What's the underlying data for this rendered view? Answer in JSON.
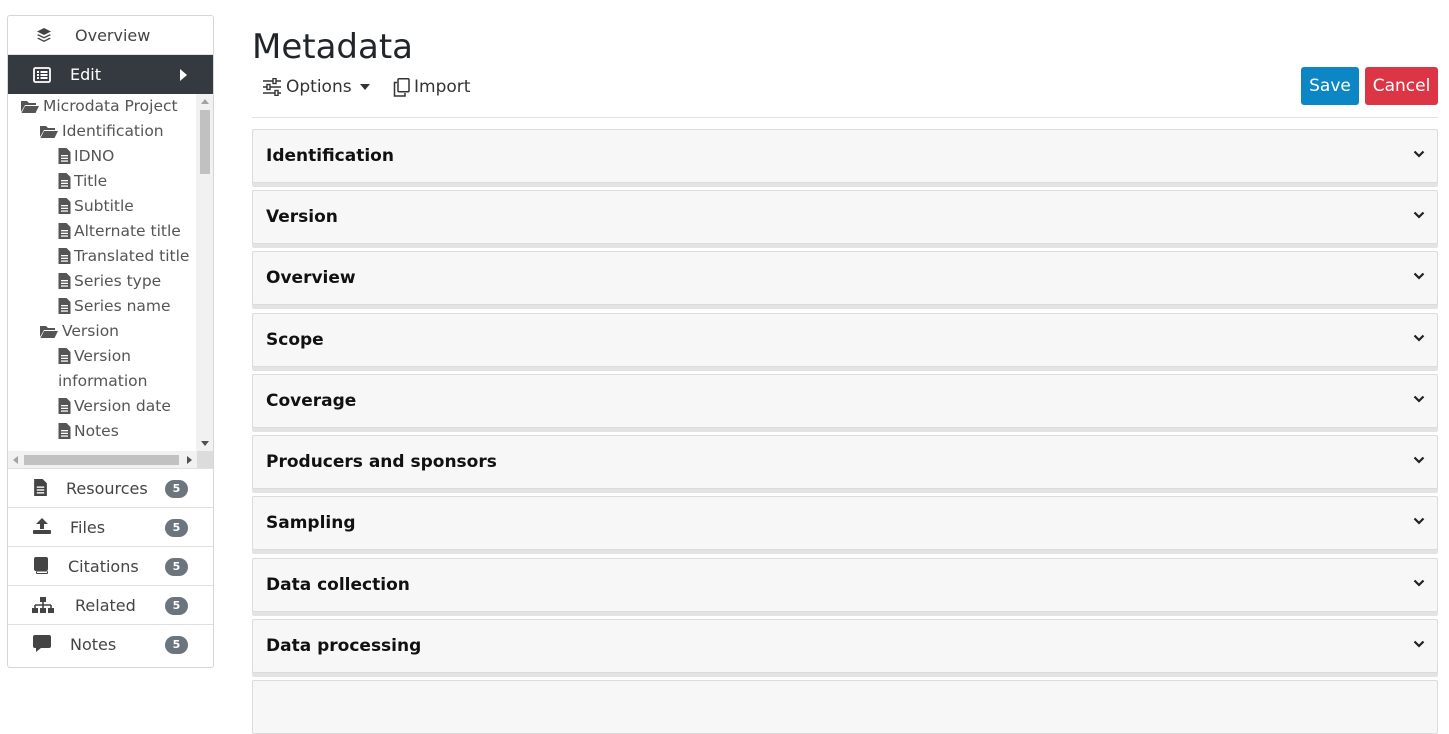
{
  "sidebar": {
    "overview_label": "Overview",
    "edit_label": "Edit",
    "tree": {
      "root": "Microdata Project",
      "items": [
        {
          "label": "Identification",
          "type": "folder"
        },
        {
          "label": "IDNO",
          "type": "file"
        },
        {
          "label": "Title",
          "type": "file"
        },
        {
          "label": "Subtitle",
          "type": "file"
        },
        {
          "label": "Alternate title",
          "type": "file"
        },
        {
          "label": "Translated title",
          "type": "file"
        },
        {
          "label": "Series type",
          "type": "file"
        },
        {
          "label": "Series name",
          "type": "file"
        },
        {
          "label": "Version",
          "type": "folder"
        },
        {
          "label": "Version",
          "type": "file",
          "continuation": "information"
        },
        {
          "label": "Version date",
          "type": "file"
        },
        {
          "label": "Notes",
          "type": "file"
        }
      ]
    },
    "nav": [
      {
        "label": "Resources",
        "count": "5",
        "icon": "file-icon"
      },
      {
        "label": "Files",
        "count": "5",
        "icon": "upload-icon"
      },
      {
        "label": "Citations",
        "count": "5",
        "icon": "book-icon"
      },
      {
        "label": "Related",
        "count": "5",
        "icon": "sitemap-icon"
      },
      {
        "label": "Notes",
        "count": "5",
        "icon": "comment-icon"
      }
    ]
  },
  "main": {
    "title": "Metadata",
    "options_label": "Options",
    "import_label": "Import",
    "save_label": "Save",
    "cancel_label": "Cancel",
    "sections": [
      "Identification",
      "Version",
      "Overview",
      "Scope",
      "Coverage",
      "Producers and sponsors",
      "Sampling",
      "Data collection",
      "Data processing"
    ]
  },
  "colors": {
    "save": "#0d86c6",
    "cancel": "#dc3545",
    "active_nav": "#343a40",
    "badge": "#6c757d"
  }
}
